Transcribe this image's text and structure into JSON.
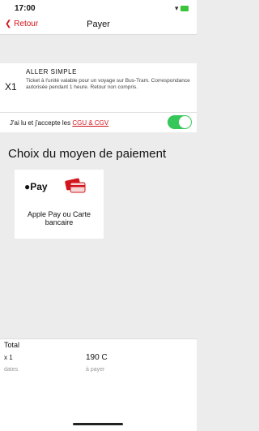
{
  "status": {
    "time": "17:00"
  },
  "nav": {
    "back_label": "Retour",
    "title": "Payer"
  },
  "ticket": {
    "quantity": "X1",
    "name": "ALLER SIMPLE",
    "description": "Ticket à l'unité valable pour un voyage sur Bus-Tram. Correspondance autorisée pendant 1 heure. Retour non compris."
  },
  "terms": {
    "text": "J'ai lu et j'accepte les ",
    "link": "CGU & CGV",
    "toggle_on": true
  },
  "payment": {
    "section_title": "Choix du moyen de paiement",
    "options": [
      {
        "logo": "Pay",
        "label": "Apple Pay ou Carte bancaire"
      }
    ]
  },
  "total": {
    "label": "Total",
    "quantity": "x 1",
    "price": "190 C",
    "dates": "dates",
    "to_pay": "à payer"
  },
  "colors": {
    "accent": "#d3141c",
    "toggle": "#35c759"
  }
}
